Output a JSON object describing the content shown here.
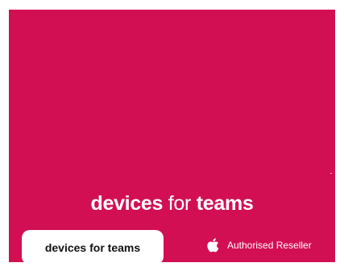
{
  "banner": {
    "headline": {
      "part1": "devices",
      "part2": " for ",
      "part3": "teams"
    },
    "button_label": "devices for teams",
    "reseller_label": "Authorised Reseller",
    "reseller_icon": "apple-logo-icon",
    "colors": {
      "background": "#d30f54",
      "text": "#ffffff",
      "button_bg": "#ffffff",
      "button_text": "#111111"
    }
  }
}
